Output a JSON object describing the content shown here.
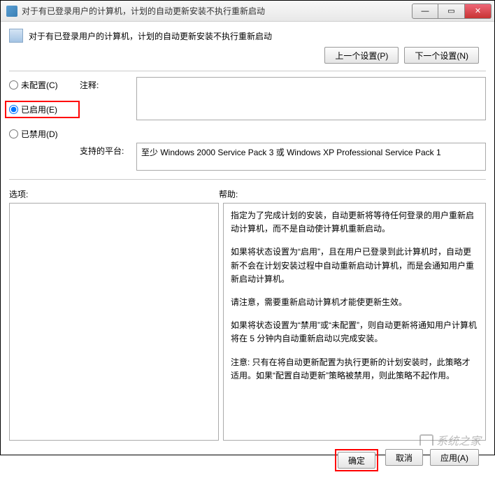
{
  "window": {
    "title": "对于有已登录用户的计算机，计划的自动更新安装不执行重新启动"
  },
  "header": {
    "title": "对于有已登录用户的计算机，计划的自动更新安装不执行重新启动"
  },
  "nav": {
    "prev": "上一个设置(P)",
    "next": "下一个设置(N)"
  },
  "radios": {
    "not_configured": "未配置(C)",
    "enabled": "已启用(E)",
    "disabled": "已禁用(D)"
  },
  "fields": {
    "comment_label": "注释:",
    "comment_value": "",
    "platform_label": "支持的平台:",
    "platform_value": "至少 Windows 2000 Service Pack 3 或 Windows XP Professional Service Pack 1"
  },
  "sections": {
    "options_label": "选项:",
    "help_label": "帮助:"
  },
  "help_text": {
    "p1": "指定为了完成计划的安装，自动更新将等待任何登录的用户重新启动计算机，而不是自动使计算机重新启动。",
    "p2": "如果将状态设置为“启用”，且在用户已登录到此计算机时，自动更新不会在计划安装过程中自动重新启动计算机，而是会通知用户重新启动计算机。",
    "p3": "请注意，需要重新启动计算机才能使更新生效。",
    "p4": "如果将状态设置为“禁用”或“未配置”，则自动更新将通知用户计算机将在 5 分钟内自动重新启动以完成安装。",
    "p5": "注意: 只有在将自动更新配置为执行更新的计划安装时，此策略才适用。如果“配置自动更新”策略被禁用，则此策略不起作用。"
  },
  "buttons": {
    "ok": "确定",
    "cancel": "取消",
    "apply": "应用(A)"
  },
  "watermark": "系统之家"
}
